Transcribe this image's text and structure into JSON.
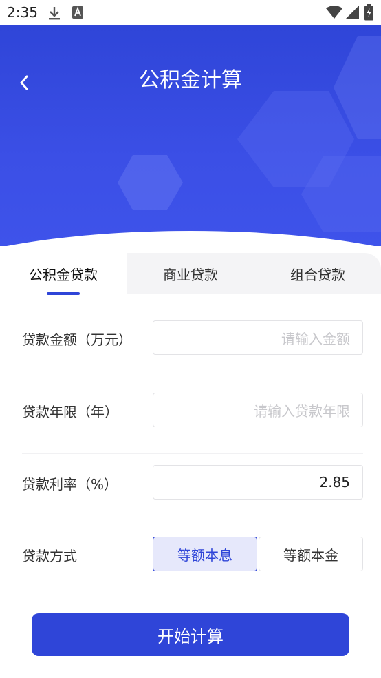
{
  "status_bar": {
    "time": "2:35"
  },
  "header": {
    "title": "公积金计算"
  },
  "tabs": [
    {
      "label": "公积金贷款",
      "active": true
    },
    {
      "label": "商业贷款",
      "active": false
    },
    {
      "label": "组合贷款",
      "active": false
    }
  ],
  "form": {
    "amount": {
      "label": "贷款金额（万元）",
      "placeholder": "请输入金额",
      "value": ""
    },
    "years": {
      "label": "贷款年限（年）",
      "placeholder": "请输入贷款年限",
      "value": ""
    },
    "rate": {
      "label": "贷款利率（%）",
      "value": "2.85"
    },
    "method": {
      "label": "贷款方式",
      "options": [
        "等额本息",
        "等额本金"
      ],
      "selected": "等额本息"
    }
  },
  "actions": {
    "calculate_label": "开始计算"
  },
  "colors": {
    "primary": "#2f45d8",
    "selected_bg": "#e6e8fb",
    "tab_bg": "#f4f4f6"
  }
}
